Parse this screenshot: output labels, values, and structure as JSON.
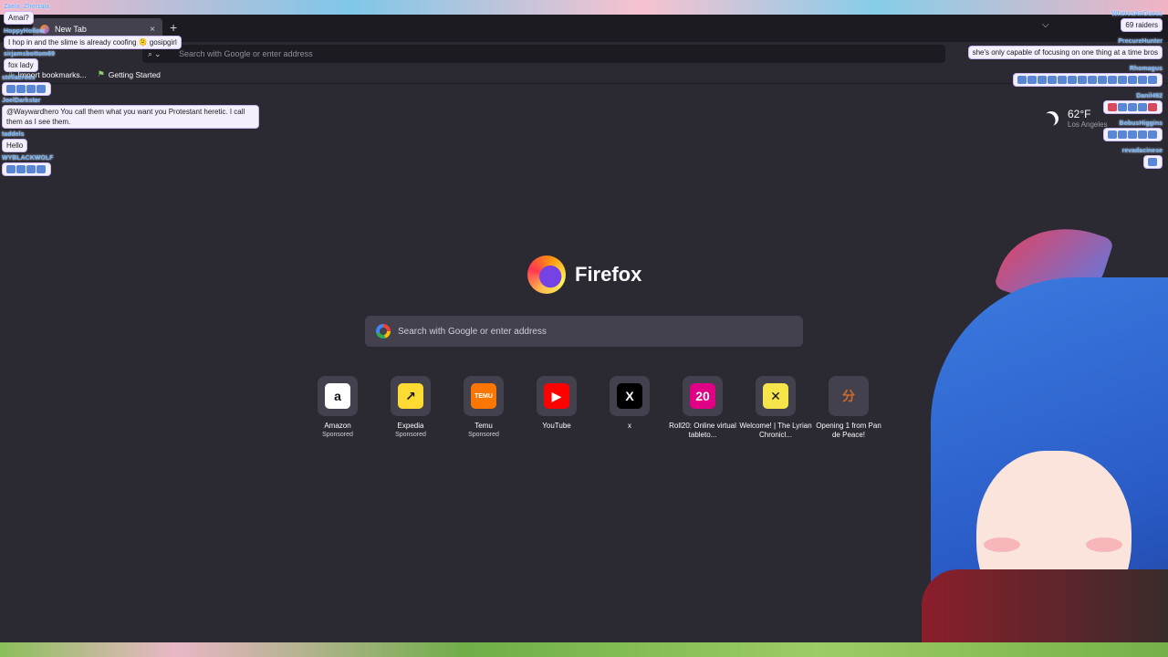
{
  "browser": {
    "tab_title": "New Tab",
    "new_tab_symbol": "+",
    "close_symbol": "×",
    "tab_list_symbol": "⌵",
    "urlbar_placeholder": "Search with Google or enter address",
    "bookmarks": [
      {
        "label": "Import bookmarks...",
        "icon": "import-icon"
      },
      {
        "label": "Getting Started",
        "icon": "firefox-icon"
      }
    ]
  },
  "newtab": {
    "brand": "Firefox",
    "search_placeholder": "Search with Google or enter address",
    "tiles": [
      {
        "label": "Amazon",
        "sub": "Sponsored",
        "glyph": "a",
        "bg": "#ffffff",
        "fg": "#111111"
      },
      {
        "label": "Expedia",
        "sub": "Sponsored",
        "glyph": "↗",
        "bg": "#fddb32",
        "fg": "#111111"
      },
      {
        "label": "Temu",
        "sub": "Sponsored",
        "glyph": "TEMU",
        "bg": "#fb7701",
        "fg": "#ffffff"
      },
      {
        "label": "YouTube",
        "sub": "",
        "glyph": "▶",
        "bg": "#ff0000",
        "fg": "#ffffff"
      },
      {
        "label": "x",
        "sub": "",
        "glyph": "X",
        "bg": "#000000",
        "fg": "#ffffff"
      },
      {
        "label": "Roll20: Online virtual tableto...",
        "sub": "",
        "glyph": "20",
        "bg": "#e10085",
        "fg": "#ffffff"
      },
      {
        "label": "Welcome! | The Lyrian Chronicl...",
        "sub": "",
        "glyph": "✕",
        "bg": "#f5e44a",
        "fg": "#111111"
      },
      {
        "label": "Opening 1 from Pan de Peace!",
        "sub": "",
        "glyph": "分",
        "bg": "#42414d",
        "fg": "#d26a2a"
      }
    ],
    "weather": {
      "temp": "62°F",
      "location": "Los Angeles"
    }
  },
  "chat_left": [
    {
      "user": "Zaela_Zherzaia",
      "text": "Amai?"
    },
    {
      "user": "HoppyHollow",
      "text": "I hop in and the slime is already coofing 🫠 gosipgirl"
    },
    {
      "user": "sirjamsbottom69",
      "text": "fox lady"
    },
    {
      "user": "stellacross",
      "text": ""
    },
    {
      "user": "JoelDarkstar",
      "text": "@Waywardhero You call them what you want you Protestant heretic. I call them as I see them."
    },
    {
      "user": "taddels",
      "text": "Hello"
    },
    {
      "user": "WYBLACKWOLF",
      "text": ""
    }
  ],
  "chat_right": [
    {
      "user": "WheresAnGuess",
      "text": "69 raiders"
    },
    {
      "user": "PrecureHunter",
      "text": "she's only capable of focusing on one thing at a time bros"
    },
    {
      "user": "Rhomagus",
      "text": ""
    },
    {
      "user": "Danil492",
      "text": ""
    },
    {
      "user": "BobusHiggins",
      "text": ""
    },
    {
      "user": "revadacinese",
      "text": ""
    }
  ],
  "colors": {
    "page_bg": "#2b2a33",
    "tabstrip_bg": "#1c1b22",
    "field_bg": "#42414d",
    "text": "#fbfbfe"
  }
}
